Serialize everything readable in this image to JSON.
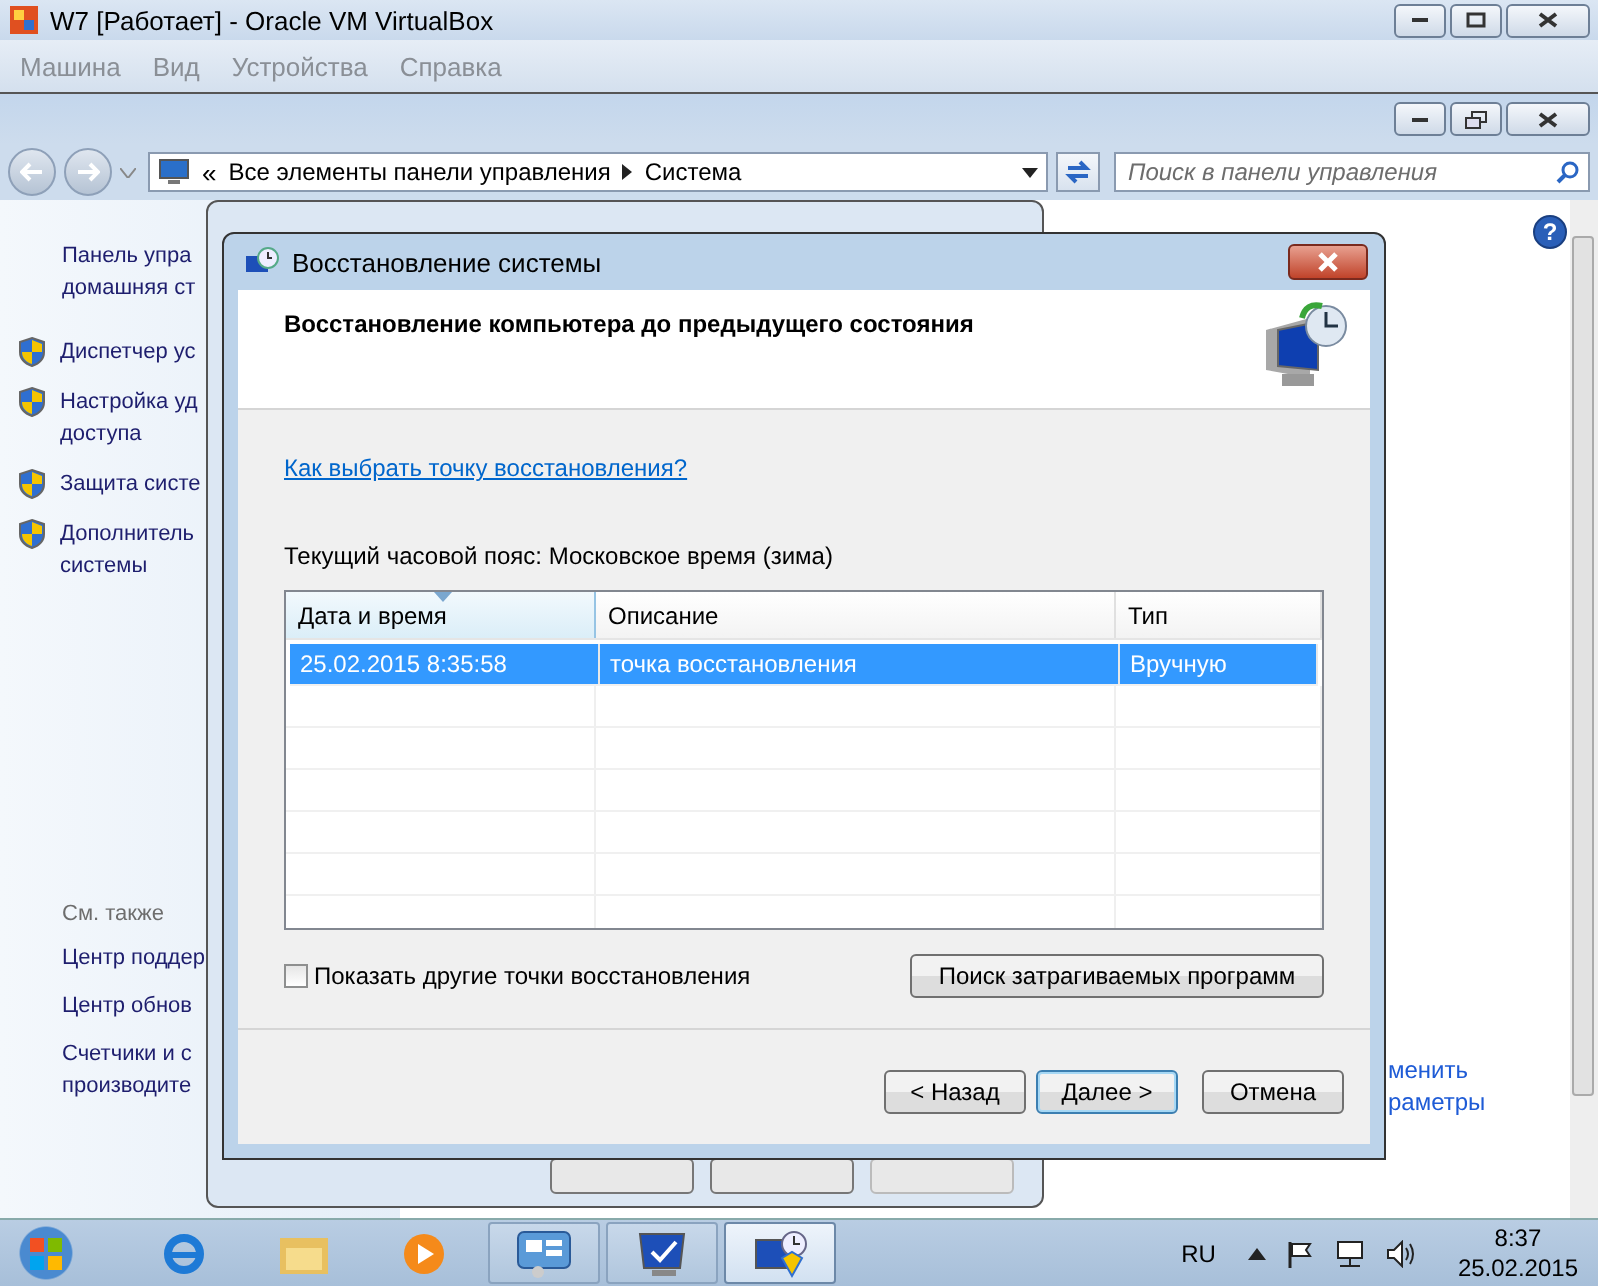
{
  "vbox": {
    "title": "W7 [Работает] - Oracle VM VirtualBox",
    "menu": [
      "Машина",
      "Вид",
      "Устройства",
      "Справка"
    ]
  },
  "explorer": {
    "chevron": "«",
    "help": "?",
    "breadcrumb": [
      "Все элементы панели управления",
      "Система"
    ],
    "search": {
      "placeholder": "Поиск в панели управления"
    },
    "sidebar": {
      "items": [
        {
          "kind": "home",
          "text": "Панель упра\nдомашняя ст"
        },
        {
          "kind": "shield",
          "text": "Диспетчер ус"
        },
        {
          "kind": "shield",
          "text": "Настройка уд\nдоступа"
        },
        {
          "kind": "shield",
          "text": "Защита систе"
        },
        {
          "kind": "shield",
          "text": "Дополнитель\nсистемы"
        }
      ],
      "see_also": {
        "title": "См. также",
        "links": [
          "Центр поддер",
          "Центр обнов",
          "Счетчики и с\nпроизводите"
        ]
      }
    },
    "right_link": "менить\nраметры"
  },
  "dialog": {
    "title": "Восстановление системы",
    "heading": "Восстановление компьютера до предыдущего состояния",
    "help_link": "Как выбрать точку восстановления?",
    "timezone": "Текущий часовой пояс: Московское время (зима)",
    "table": {
      "columns": [
        {
          "label": "Дата и время",
          "sorted": true
        },
        {
          "label": "Описание",
          "sorted": false
        },
        {
          "label": "Тип",
          "sorted": false
        }
      ],
      "rows": [
        {
          "cells": [
            "25.02.2015 8:35:58",
            "точка восстановления",
            "Вручную"
          ],
          "selected": true
        }
      ]
    },
    "show_more": {
      "label": "Показать другие точки восстановления",
      "checked": false
    },
    "scan_button": "Поиск затрагиваемых программ",
    "buttons": [
      {
        "label": "< Назад",
        "default": false
      },
      {
        "label": "Далее >",
        "default": true
      },
      {
        "label": "Отмена",
        "default": false
      }
    ]
  },
  "taskbar": {
    "pinned": [
      {
        "kind": "ie"
      },
      {
        "kind": "folder"
      },
      {
        "kind": "media"
      }
    ],
    "tasks": [
      {
        "kind": "panel",
        "selected": false
      },
      {
        "kind": "monitor",
        "selected": false
      },
      {
        "kind": "restore",
        "selected": true
      }
    ],
    "tray": {
      "language": "RU",
      "time": "8:37",
      "date": "25.02.2015"
    }
  }
}
